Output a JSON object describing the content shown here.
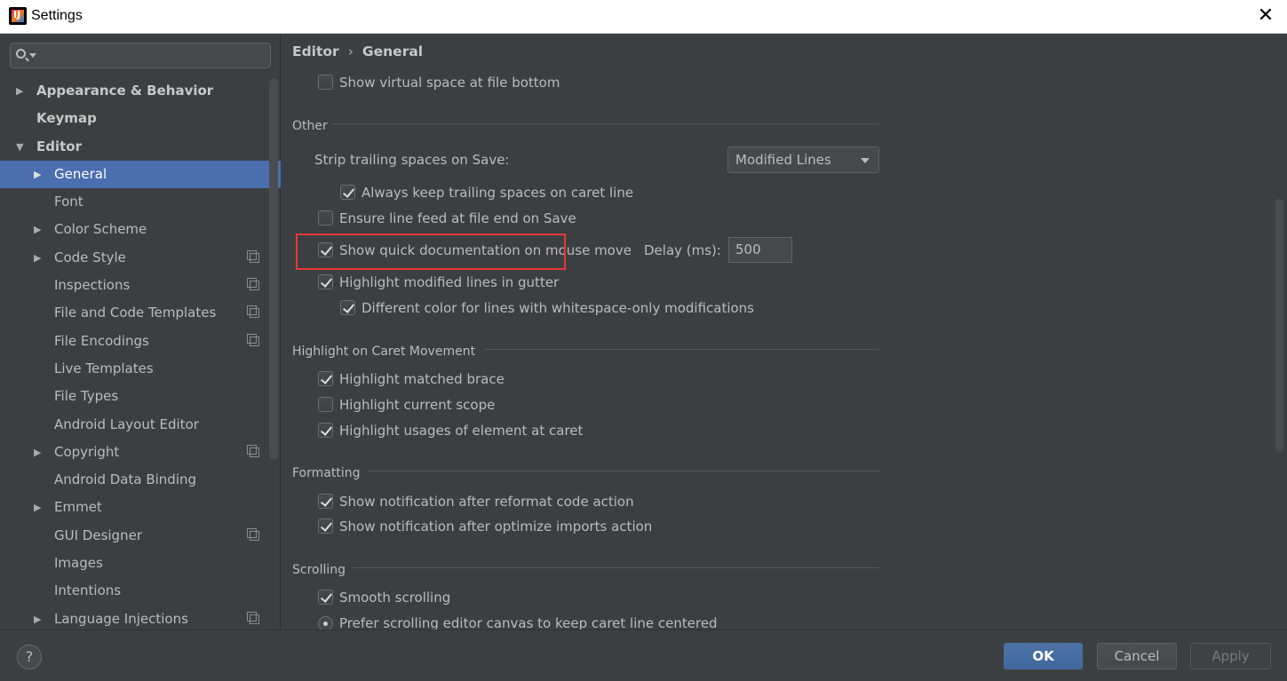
{
  "window": {
    "title": "Settings",
    "close_glyph": "✕",
    "icon_letters": "IJ"
  },
  "search": {
    "placeholder": "",
    "value": ""
  },
  "sidebar": {
    "items": [
      {
        "label": "Appearance & Behavior",
        "level": 0,
        "arrow": "▶",
        "bold": true
      },
      {
        "label": "Keymap",
        "level": 0,
        "arrow": "",
        "bold": true
      },
      {
        "label": "Editor",
        "level": 0,
        "arrow": "▼",
        "bold": true
      },
      {
        "label": "General",
        "level": 1,
        "arrow": "▶",
        "selected": true
      },
      {
        "label": "Font",
        "level": 1,
        "arrow": ""
      },
      {
        "label": "Color Scheme",
        "level": 1,
        "arrow": "▶"
      },
      {
        "label": "Code Style",
        "level": 1,
        "arrow": "▶",
        "project": true
      },
      {
        "label": "Inspections",
        "level": 1,
        "arrow": "",
        "project": true
      },
      {
        "label": "File and Code Templates",
        "level": 1,
        "arrow": "",
        "project": true
      },
      {
        "label": "File Encodings",
        "level": 1,
        "arrow": "",
        "project": true
      },
      {
        "label": "Live Templates",
        "level": 1,
        "arrow": ""
      },
      {
        "label": "File Types",
        "level": 1,
        "arrow": ""
      },
      {
        "label": "Android Layout Editor",
        "level": 1,
        "arrow": ""
      },
      {
        "label": "Copyright",
        "level": 1,
        "arrow": "▶",
        "project": true
      },
      {
        "label": "Android Data Binding",
        "level": 1,
        "arrow": ""
      },
      {
        "label": "Emmet",
        "level": 1,
        "arrow": "▶"
      },
      {
        "label": "GUI Designer",
        "level": 1,
        "arrow": "",
        "project": true
      },
      {
        "label": "Images",
        "level": 1,
        "arrow": ""
      },
      {
        "label": "Intentions",
        "level": 1,
        "arrow": ""
      },
      {
        "label": "Language Injections",
        "level": 1,
        "arrow": "▶",
        "project": true
      }
    ]
  },
  "breadcrumb": {
    "parent": "Editor",
    "separator": "›",
    "current": "General"
  },
  "settings": {
    "virtual_space": {
      "label": "Show virtual space at file bottom",
      "checked": false
    },
    "other": {
      "title": "Other",
      "strip_label": "Strip trailing spaces on Save:",
      "strip_value": "Modified Lines",
      "keep_trailing": {
        "label": "Always keep trailing spaces on caret line",
        "checked": true
      },
      "line_feed": {
        "label": "Ensure line feed at file end on Save",
        "checked": false
      },
      "quick_doc": {
        "label": "Show quick documentation on mouse move",
        "checked": true
      },
      "delay_label": "Delay (ms):",
      "delay_value": "500",
      "highlight_modified": {
        "label": "Highlight modified lines in gutter",
        "checked": true
      },
      "different_color": {
        "label": "Different color for lines with whitespace-only modifications",
        "checked": true
      }
    },
    "caret": {
      "title": "Highlight on Caret Movement",
      "matched_brace": {
        "label": "Highlight matched brace",
        "checked": true
      },
      "current_scope": {
        "label": "Highlight current scope",
        "checked": false
      },
      "usages": {
        "label": "Highlight usages of element at caret",
        "checked": true
      }
    },
    "formatting": {
      "title": "Formatting",
      "reformat": {
        "label": "Show notification after reformat code action",
        "checked": true
      },
      "optimize": {
        "label": "Show notification after optimize imports action",
        "checked": true
      }
    },
    "scrolling": {
      "title": "Scrolling",
      "smooth": {
        "label": "Smooth scrolling",
        "checked": true
      },
      "prefer_canvas": {
        "label": "Prefer scrolling editor canvas to keep caret line centered",
        "selected": true
      }
    }
  },
  "footer": {
    "help": "?",
    "ok": "OK",
    "cancel": "Cancel",
    "apply": "Apply"
  },
  "colors": {
    "background": "#3c3f41",
    "selection": "#4b6eaf",
    "highlight_box": "#e53935"
  }
}
